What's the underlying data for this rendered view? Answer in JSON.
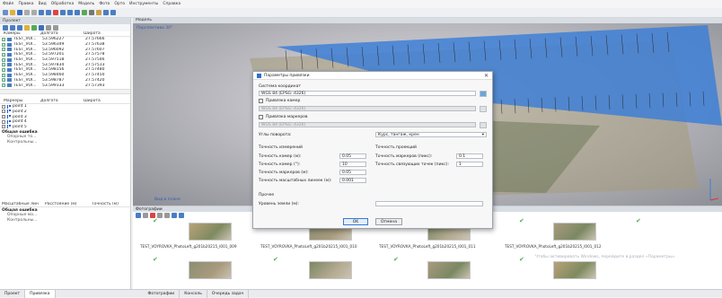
{
  "menu": [
    "Файл",
    "Правка",
    "Вид",
    "Обработка",
    "Модель",
    "Фото",
    "Орто",
    "Инструменты",
    "Справка"
  ],
  "workspace": {
    "title": "Пролект",
    "cameras_header": [
      "Камеры",
      "Долгота",
      "Широта"
    ],
    "cameras": [
      {
        "name": "TEST_VOI...",
        "lon": "53.596227",
        "lat": "27.57666"
      },
      {
        "name": "TEST_VOI...",
        "lon": "53.596349",
        "lat": "27.57638"
      },
      {
        "name": "TEST_VOI...",
        "lon": "53.596092",
        "lat": "27.57607"
      },
      {
        "name": "TEST_VOI...",
        "lon": "53.597201",
        "lat": "27.57578"
      },
      {
        "name": "TEST_VOI...",
        "lon": "53.597518",
        "lat": "27.57546"
      },
      {
        "name": "TEST_VOI...",
        "lon": "53.597834",
        "lat": "27.57513"
      },
      {
        "name": "TEST_VOI...",
        "lon": "53.598156",
        "lat": "27.57480"
      },
      {
        "name": "TEST_VOI...",
        "lon": "53.598460",
        "lat": "27.57450"
      },
      {
        "name": "TEST_VOI...",
        "lon": "53.598787",
        "lat": "27.57420"
      },
      {
        "name": "TEST_VOI...",
        "lon": "53.599133",
        "lat": "27.57393"
      }
    ],
    "markers_header": [
      "Маркеры",
      "Долгота",
      "Широта"
    ],
    "markers": [
      "point 1",
      "point 2",
      "point 3",
      "point 4",
      "point 5"
    ],
    "total_error": "Общая ошибка",
    "sub1": "Опорные то...",
    "sub2": "Контрольны...",
    "scale_header": [
      "Масштабные лин",
      "Расстояние (м)",
      "Точность (м)"
    ],
    "total_error2": "Общая ошибка",
    "sub3": "Опорные ма...",
    "sub4": "Контрольны..."
  },
  "viewport": {
    "title": "Модель",
    "label": "Перспектива 30°",
    "bottom_label": "Вид в плане"
  },
  "photos": {
    "title": "Фотографии",
    "labels": [
      "TEST_VOYROVKA_PhotoLeft_g201b20215_I001_009",
      "TEST_VOYROVKA_PhotoLeft_g201b20215_I001_010",
      "TEST_VOYROVKA_PhotoLeft_g201b20215_I001_011",
      "TEST_VOYROVKA_PhotoLeft_g201b20215_I001_012"
    ],
    "watermark": "Чтобы активировать Windows, перейдите в раздел «Параметры»."
  },
  "status_tabs": [
    "Проект",
    "Привязка",
    "Фотографии",
    "Консоль",
    "Очередь задач"
  ],
  "dialog": {
    "title": "Параметры привязки",
    "crs_label": "Система координат",
    "crs_value": "WGS 84 (EPSG::4326)",
    "camera_ref_label": "Привязка камер",
    "camera_ref_value": "WGS 84 (EPSG::4326)",
    "marker_ref_label": "Привязка маркеров",
    "marker_ref_value": "WGS 84 (EPSG::4326)",
    "angles_label": "Углы поворота:",
    "angles_value": "Курс, тангаж, крен",
    "measure_accuracy_title": "Точность измерений",
    "camera_acc_label": "Точность камер (м):",
    "camera_acc_value": "0.05",
    "angle_acc_label": "Точность камер (°):",
    "angle_acc_value": "10",
    "marker_acc_label": "Точность маркеров (м):",
    "marker_acc_value": "0.05",
    "scale_acc_label": "Точность масштабных линеек (м):",
    "scale_acc_value": "0.001",
    "image_accuracy_title": "Точность проекций",
    "marker_px_label": "Точность маркеров (пикс):",
    "marker_px_value": "0.1",
    "tie_px_label": "Точность связующих точек (пикс):",
    "tie_px_value": "1",
    "misc_title": "Прочее",
    "ground_alt_label": "Уровень земли (м):",
    "ok": "OK",
    "cancel": "Отмена"
  }
}
